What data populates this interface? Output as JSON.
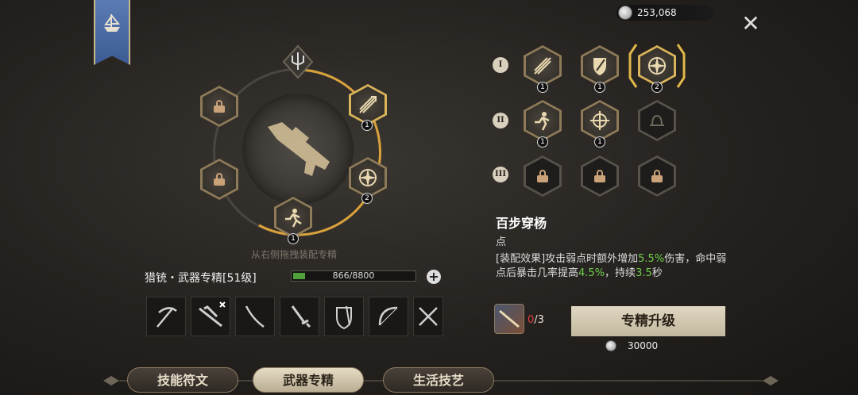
{
  "currency": {
    "amount": "253,068",
    "icon": "silver-coin-icon"
  },
  "close_label": "✕",
  "hint": "从右侧拖拽装配专精",
  "weapon": {
    "title": "猎铳・武器专精[51级]",
    "xp_text": "866/8800",
    "xp_fraction": 0.098
  },
  "ring_slots": [
    {
      "icon": "lock-icon",
      "locked": true
    },
    {
      "icon": "arrow-volley-icon",
      "level": "1"
    },
    {
      "icon": "lock-icon",
      "locked": true
    },
    {
      "icon": "compass-star-icon",
      "level": "2"
    },
    {
      "icon": "sprinting-figure-icon",
      "level": "1"
    }
  ],
  "tiers": [
    {
      "roman": "I",
      "nodes": [
        {
          "icon": "arrow-volley-icon",
          "level": "1"
        },
        {
          "icon": "shield-icon",
          "level": "1"
        },
        {
          "icon": "compass-star-icon",
          "level": "2",
          "selected": true
        }
      ]
    },
    {
      "roman": "II",
      "nodes": [
        {
          "icon": "sprinting-figure-icon",
          "level": "1"
        },
        {
          "icon": "crosshair-icon",
          "level": "1"
        },
        {
          "icon": "bell-icon",
          "dim": true
        }
      ]
    },
    {
      "roman": "III",
      "nodes": [
        {
          "icon": "lock-icon",
          "locked": true
        },
        {
          "icon": "lock-icon",
          "locked": true
        },
        {
          "icon": "lock-icon",
          "locked": true
        }
      ]
    }
  ],
  "talent": {
    "name": "百步穿杨",
    "subtitle": "点",
    "desc_a": "[装配效果]攻击弱点时额外增加",
    "val1": "5.5%",
    "desc_b": "伤害，命中弱点后暴击几率提高",
    "val2": "4.5%",
    "desc_c": "，持续",
    "val3": "3.5",
    "desc_d": "秒"
  },
  "material": {
    "current": "0",
    "total": "/3"
  },
  "upgrade_label": "专精升级",
  "upgrade_cost": "30000",
  "tabs": [
    "技能符文",
    "武器专精",
    "生活技艺"
  ],
  "active_tab": 1,
  "colors": {
    "gold": "#d9b45a",
    "green": "#6fcf4a",
    "red": "#e04040"
  }
}
